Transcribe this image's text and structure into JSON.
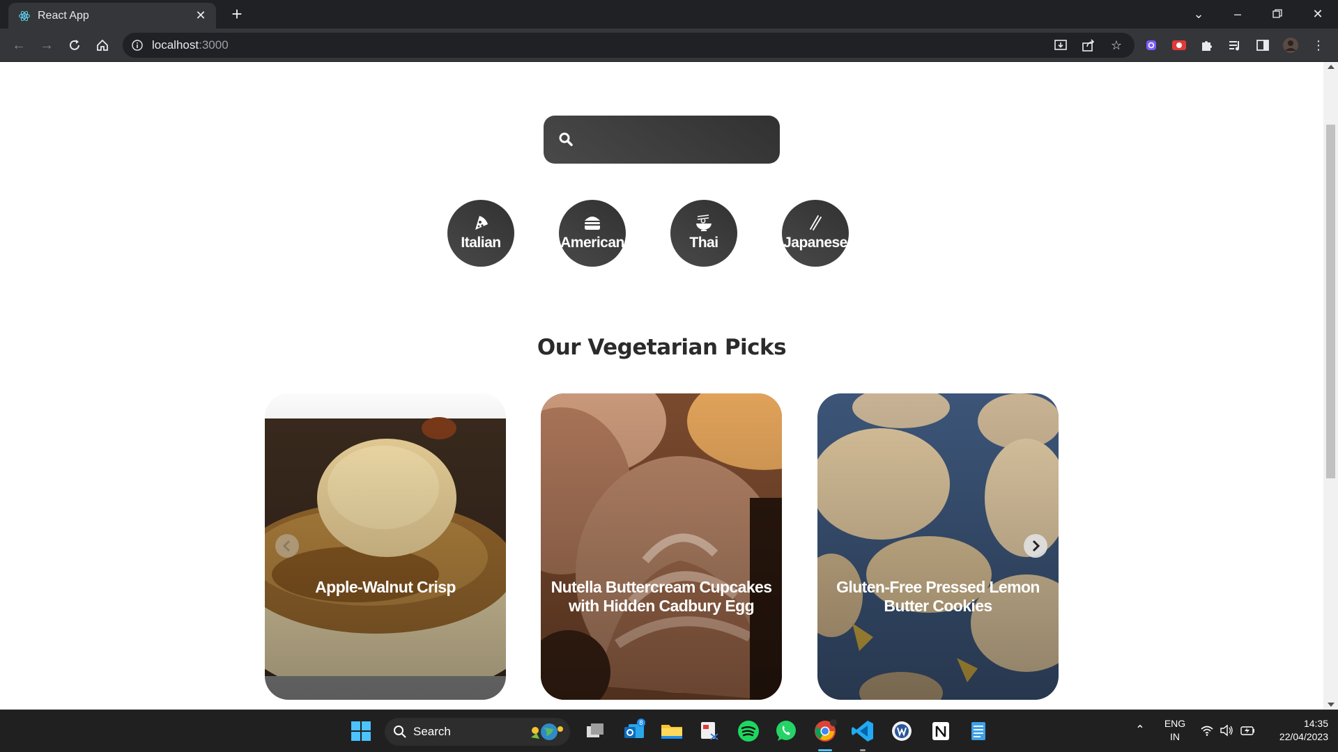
{
  "browser": {
    "tab_title": "React App",
    "url_host": "localhost",
    "url_port": ":3000"
  },
  "search": {
    "value": "",
    "placeholder": ""
  },
  "categories": [
    {
      "label": "Italian",
      "icon": "pizza-icon"
    },
    {
      "label": "American",
      "icon": "burger-icon"
    },
    {
      "label": "Thai",
      "icon": "noodle-bowl-icon"
    },
    {
      "label": "Japanese",
      "icon": "chopsticks-icon"
    }
  ],
  "section": {
    "title": "Our Vegetarian Picks"
  },
  "recipes": [
    {
      "title": "Apple-Walnut Crisp"
    },
    {
      "title": "Nutella Buttercream Cupcakes with Hidden Cadbury Egg"
    },
    {
      "title": "Gluten-Free Pressed Lemon Butter Cookies"
    }
  ],
  "taskbar": {
    "search_label": "Search",
    "badge_count": "8",
    "lang_line1": "ENG",
    "lang_line2": "IN",
    "time": "14:35",
    "date": "22/04/2023"
  },
  "colors": {
    "chrome_dark": "#202124",
    "chrome_toolbar": "#35363a",
    "category_bg": "#3b3b3b",
    "taskbar": "#202020"
  }
}
